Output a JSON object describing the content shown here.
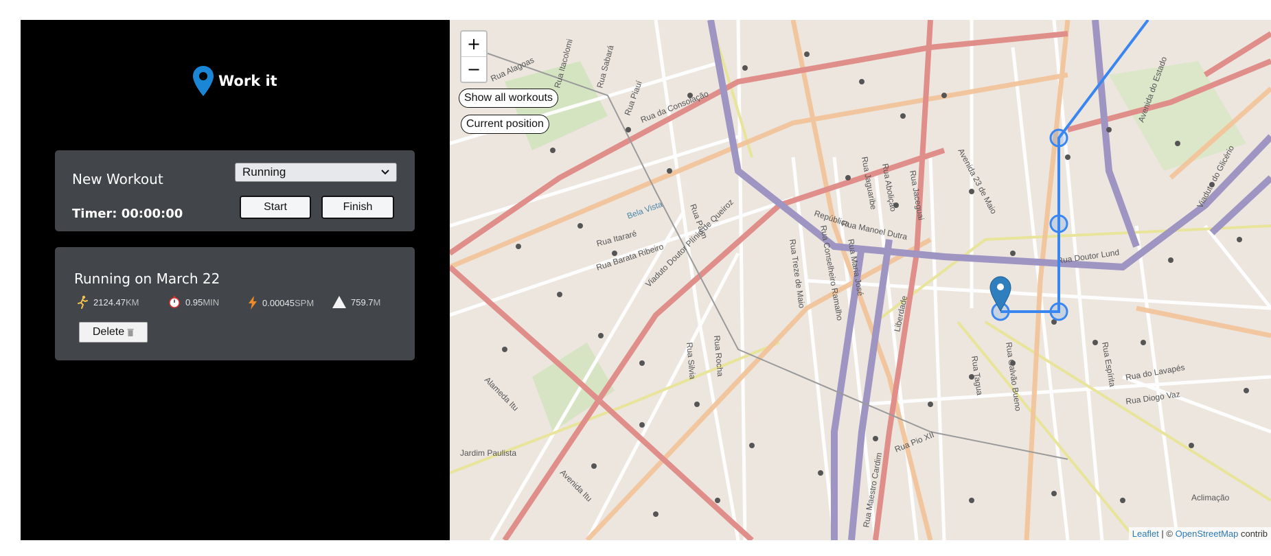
{
  "app": {
    "name": "Work it"
  },
  "form": {
    "title": "New Workout",
    "type_selected": "Running",
    "timer_label": "Timer: 00:00:00",
    "start_label": "Start",
    "finish_label": "Finish"
  },
  "workouts": [
    {
      "title": "Running on March 22",
      "stats": [
        {
          "icon": "runner-icon",
          "value": "2124.47",
          "unit": "KM"
        },
        {
          "icon": "stopwatch-icon",
          "value": "0.95",
          "unit": "MIN"
        },
        {
          "icon": "lightning-icon",
          "value": "0.00045",
          "unit": "SPM"
        },
        {
          "icon": "mountain-icon",
          "value": "759.7",
          "unit": "M"
        }
      ],
      "delete_label": "Delete"
    }
  ],
  "map": {
    "zoom_in": "+",
    "zoom_out": "−",
    "show_all_label": "Show all workouts",
    "current_position_label": "Current position",
    "attribution": {
      "leaflet": "Leaflet",
      "separator": " | © ",
      "osm": "OpenStreetMap",
      "suffix": " contrib"
    },
    "street_labels": [
      "Rua Alagoas",
      "Rua Itacolomi",
      "Rua Sabará",
      "Rua Piauí",
      "Rua da Consolação",
      "Avenida do Estado",
      "Avenida 23 de Maio",
      "Rua Jaguaribe",
      "Rua Abolição",
      "Rua Jaceguai",
      "República",
      "Bela Vista",
      "Rua Itararé",
      "Rua Barata Ribeiro",
      "Viaduto Doutor Plínio de Queiroz",
      "Rua Treze de Maio",
      "Rua Conselheiro Ramalho",
      "Rua Manoel Dutra",
      "Rua Maria José",
      "Rua Doutor Lund",
      "Viaduto do Glicério",
      "Rua Galvão Bueno",
      "Rua Tagua",
      "Rua Espírita",
      "Rua do Lavapés",
      "Rua Diogo Vaz",
      "Jardim Paulista",
      "Alameda Itu",
      "Rua Pio XII",
      "Rua Maestro Cardim",
      "Aclimação",
      "Liberdade",
      "Rua Rocha",
      "Rua Silvia",
      "Rua Paim",
      "Avenida Itu"
    ],
    "route_color": "#3a86f0",
    "marker_color": "#2f7fbf"
  }
}
